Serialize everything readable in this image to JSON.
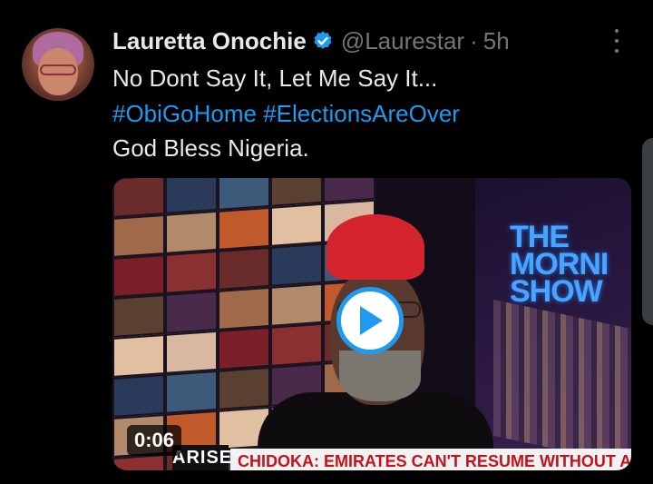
{
  "tweet": {
    "display_name": "Lauretta Onochie",
    "handle": "@Laurestar",
    "separator": "·",
    "time": "5h",
    "line1": "No Dont Say It, Let Me Say It...",
    "hashtags": [
      "#ObiGoHome",
      "#ElectionsAreOver"
    ],
    "line3": "God Bless Nigeria."
  },
  "media": {
    "duration": "0:06",
    "show_title_lines": [
      "THE",
      "MORNI",
      "SHOW"
    ],
    "channel_logo": "ARISE",
    "ticker": "CHIDOKA: EMIRATES CAN'T RESUME WITHOUT APOLOG"
  },
  "colors": {
    "background": "#000000",
    "text": "#e7e9ea",
    "secondary": "#71767b",
    "accent": "#1d9bf0"
  },
  "icons": [
    "verified-badge-icon",
    "more-options-icon",
    "play-icon"
  ]
}
